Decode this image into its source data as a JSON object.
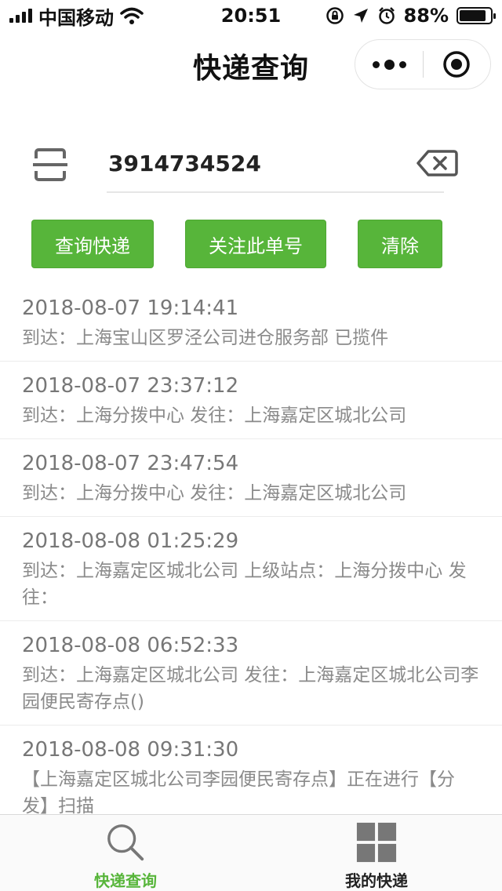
{
  "status_bar": {
    "carrier": "中国移动",
    "time": "20:51",
    "battery_pct": "88%",
    "battery_level": 0.88,
    "icons": [
      "signal-icon",
      "wifi-icon",
      "orientation-lock-icon",
      "location-icon",
      "alarm-icon",
      "battery-icon"
    ]
  },
  "nav": {
    "title": "快递查询",
    "more_icon": "more-dots-icon",
    "close_icon": "target-close-icon"
  },
  "search": {
    "value": "3914734524",
    "scan_icon": "scan-icon",
    "clear_icon": "backspace-clear-icon"
  },
  "actions": {
    "query_label": "查询快递",
    "follow_label": "关注此单号",
    "clear_label": "清除"
  },
  "timeline": [
    {
      "time": "2018-08-07 19:14:41",
      "desc": "到达：上海宝山区罗泾公司进仓服务部 已揽件"
    },
    {
      "time": "2018-08-07 23:37:12",
      "desc": "到达：上海分拨中心 发往：上海嘉定区城北公司"
    },
    {
      "time": "2018-08-07 23:47:54",
      "desc": "到达：上海分拨中心 发往：上海嘉定区城北公司"
    },
    {
      "time": "2018-08-08 01:25:29",
      "desc": "到达：上海嘉定区城北公司 上级站点：上海分拨中心 发往："
    },
    {
      "time": "2018-08-08 06:52:33",
      "desc": "到达：上海嘉定区城北公司 发往：上海嘉定区城北公司李园便民寄存点()"
    },
    {
      "time": "2018-08-08 09:31:30",
      "desc": "【上海嘉定区城北公司李园便民寄存点】正在进行【分发】扫描"
    }
  ],
  "tabs": [
    {
      "label": "快递查询",
      "icon": "search-icon",
      "active": true
    },
    {
      "label": "我的快递",
      "icon": "grid-icon",
      "active": false
    }
  ],
  "colors": {
    "accent": "#57b53a",
    "text": "#111111",
    "muted": "#888888"
  }
}
